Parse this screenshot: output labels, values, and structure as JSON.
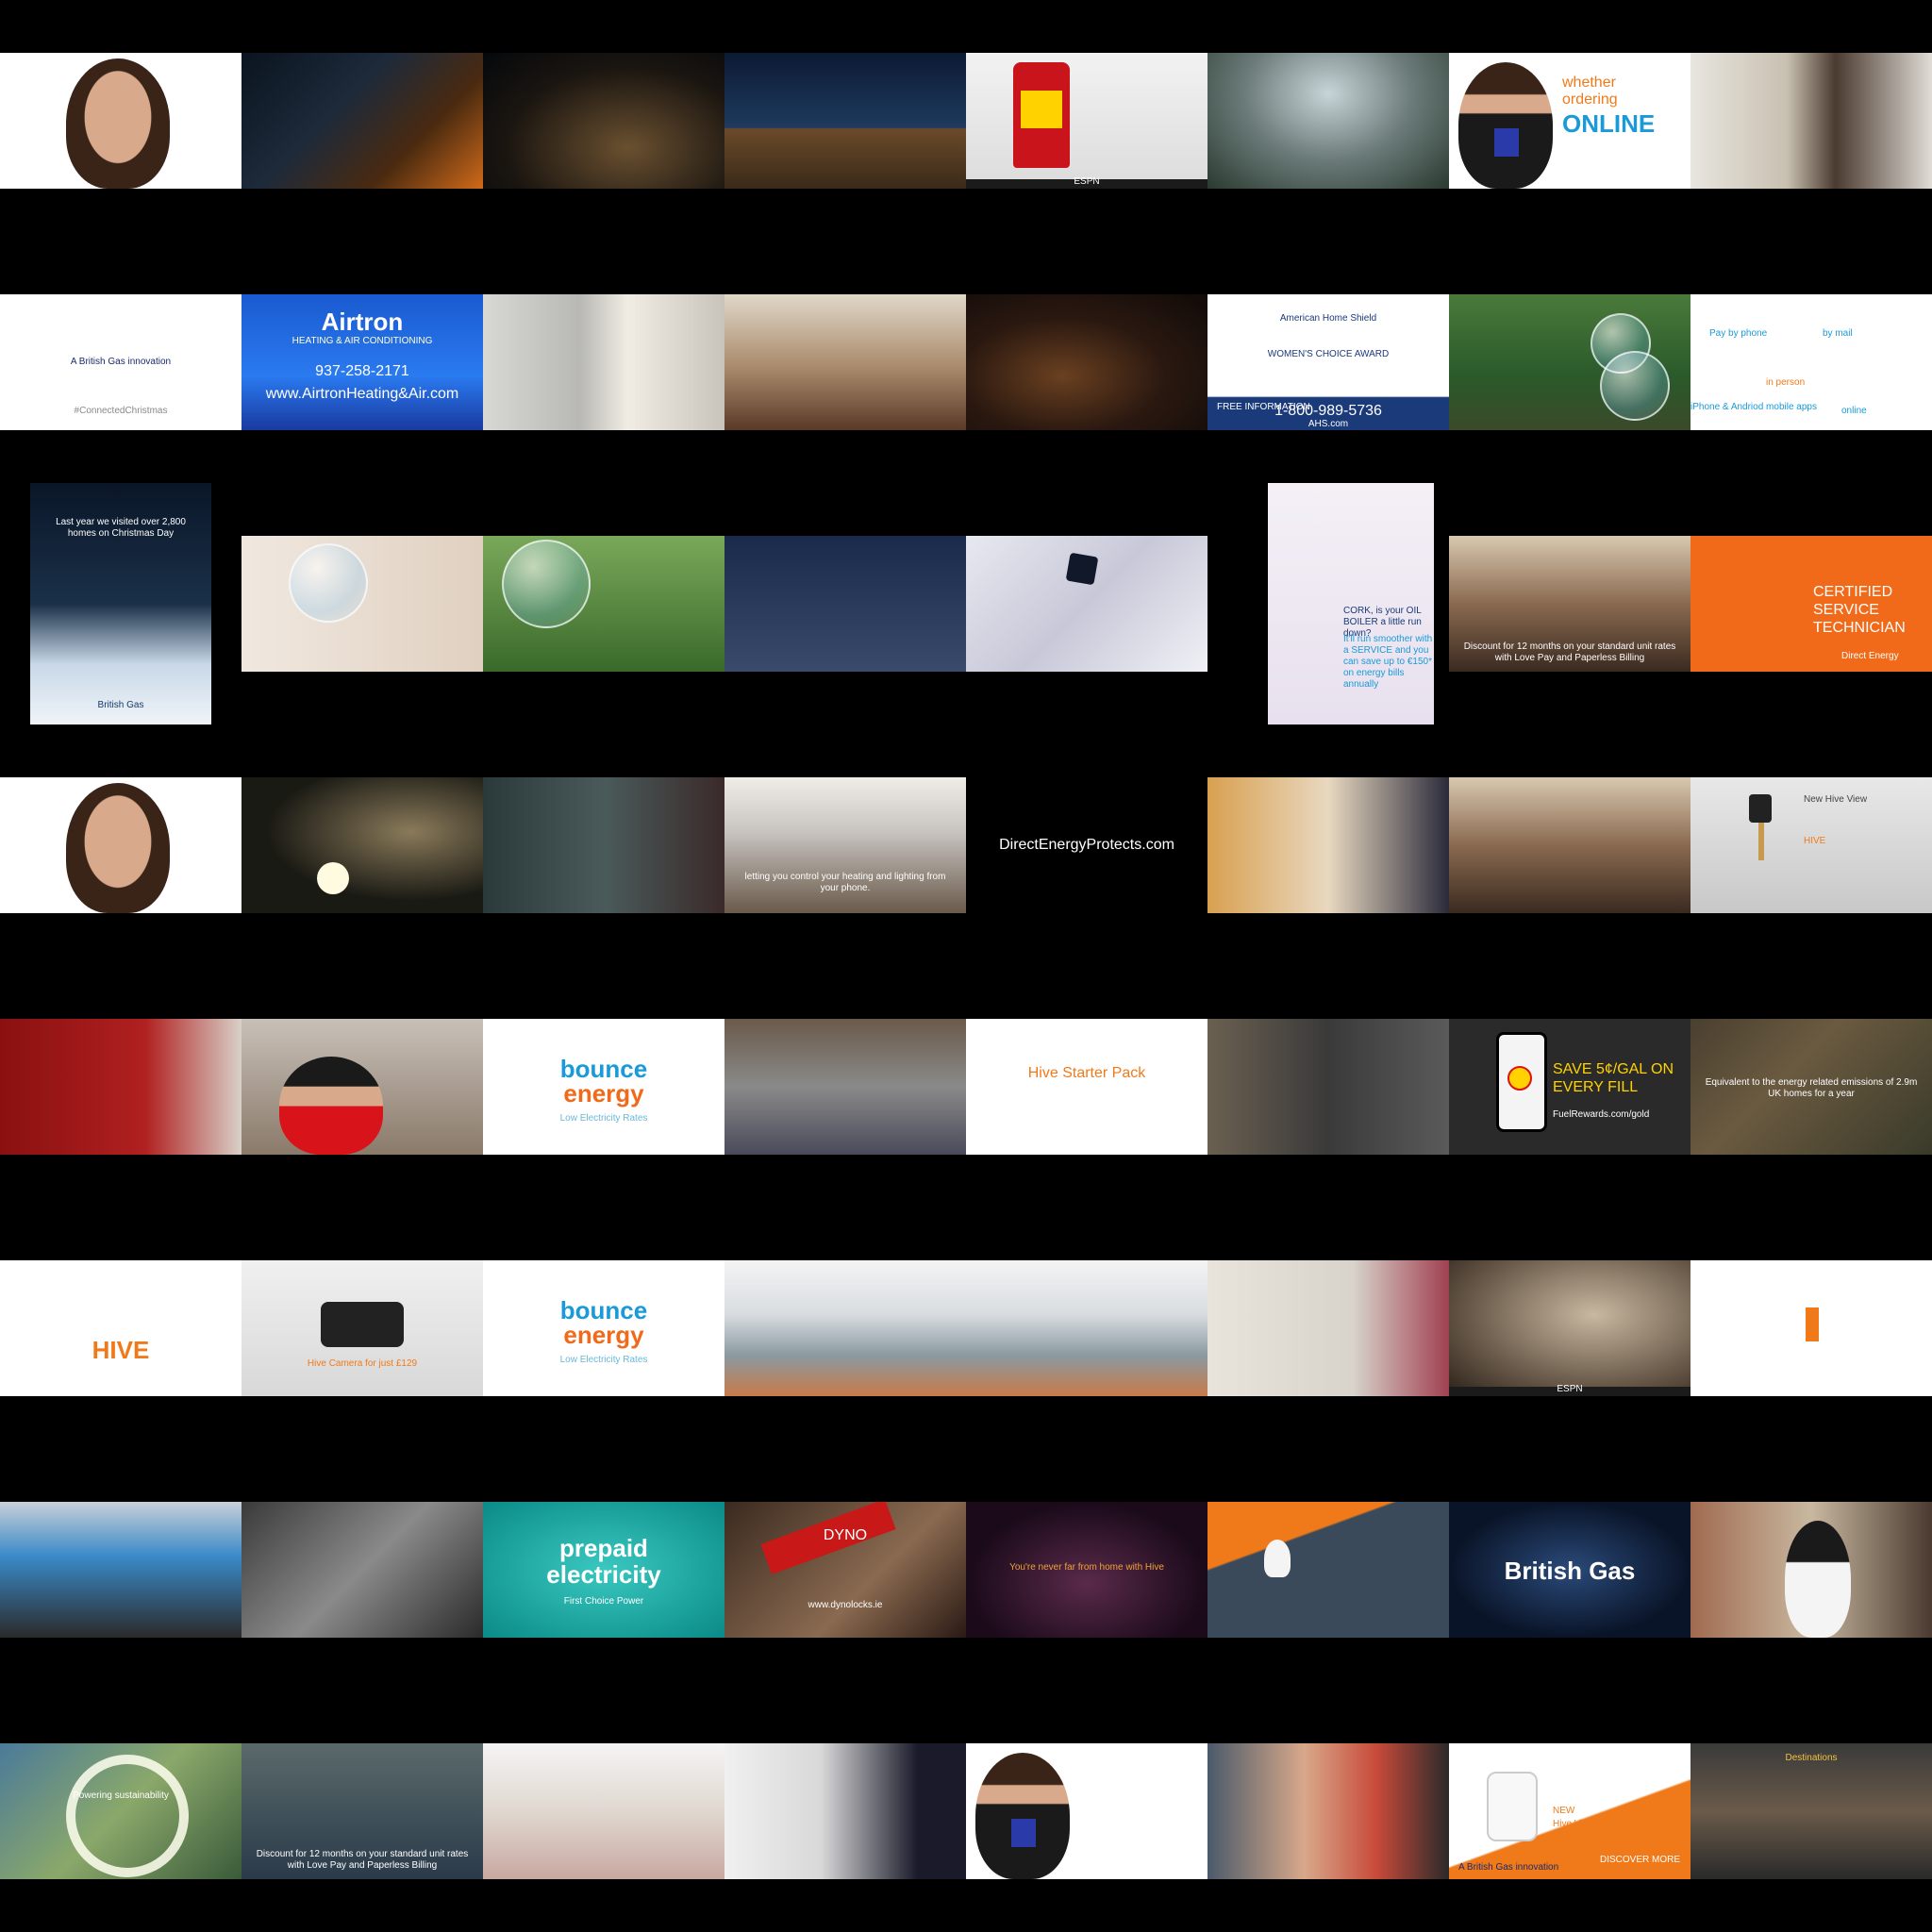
{
  "tiles": [
    {
      "id": "t00",
      "style": "face-white"
    },
    {
      "id": "t01",
      "style": "dark-oven"
    },
    {
      "id": "t02",
      "style": "night-houses"
    },
    {
      "id": "t03",
      "style": "night-cottage"
    },
    {
      "id": "t04",
      "style": "oil-bottle",
      "texts": [
        "ESPN"
      ]
    },
    {
      "id": "t05",
      "style": "misty-field"
    },
    {
      "id": "t06",
      "style": "presenter-white",
      "texts": [
        "whether",
        "ordering",
        "ONLINE"
      ]
    },
    {
      "id": "t07",
      "style": "doorway"
    },
    {
      "id": "t10",
      "style": "logo-white",
      "texts": [
        "A British Gas innovation",
        "#ConnectedChristmas"
      ]
    },
    {
      "id": "t11",
      "style": "airtron",
      "texts": [
        "Airtron",
        "HEATING & AIR CONDITIONING",
        "937-258-2171",
        "www.AirtronHeating&Air.com"
      ]
    },
    {
      "id": "t12",
      "style": "kitchen-woman"
    },
    {
      "id": "t13",
      "style": "living-couple"
    },
    {
      "id": "t14",
      "style": "night-street"
    },
    {
      "id": "t15",
      "style": "ahs",
      "texts": [
        "American Home Shield",
        "WOMEN'S CHOICE AWARD",
        "FREE INFORMATION",
        "1-800-989-5736",
        "AHS.com"
      ]
    },
    {
      "id": "t16",
      "style": "park-bubble"
    },
    {
      "id": "t17",
      "style": "contact-methods",
      "texts": [
        "Pay by phone",
        "by mail",
        "in person",
        "iPhone & Andriod mobile apps",
        "online"
      ]
    },
    {
      "id": "t20",
      "style": "poster-christmas",
      "texts": [
        "Last year we visited over 2,800 homes on Christmas Day",
        "British Gas"
      ]
    },
    {
      "id": "t21",
      "style": "shop-bubble"
    },
    {
      "id": "t22",
      "style": "forest-bubble"
    },
    {
      "id": "t23",
      "style": "floating-house"
    },
    {
      "id": "t24",
      "style": "white-device"
    },
    {
      "id": "t25",
      "style": "poster-boiler",
      "texts": [
        "CORK, is your OIL BOILER a little run down?",
        "It'll run smoother with a SERVICE and you can save up to €150* on energy bills annually"
      ]
    },
    {
      "id": "t26",
      "style": "woman-xmas",
      "texts": [
        "Discount for 12 months on your standard unit rates with Love Pay and Paperless Billing"
      ]
    },
    {
      "id": "t27",
      "style": "orange-tech",
      "texts": [
        "CERTIFIED SERVICE TECHNICIAN",
        "Direct Energy"
      ]
    },
    {
      "id": "t30",
      "style": "face-white"
    },
    {
      "id": "t31",
      "style": "dog-lights"
    },
    {
      "id": "t32",
      "style": "hallway-family"
    },
    {
      "id": "t33",
      "style": "stove",
      "texts": [
        "letting you control your heating and lighting from your phone."
      ]
    },
    {
      "id": "t34",
      "style": "black-url",
      "texts": [
        "DirectEnergyProtects.com"
      ]
    },
    {
      "id": "t35",
      "style": "door-visitors"
    },
    {
      "id": "t36",
      "style": "woman-xmas"
    },
    {
      "id": "t37",
      "style": "hive-camera",
      "texts": [
        "New Hive View",
        "HIVE"
      ]
    },
    {
      "id": "t40",
      "style": "red-wall"
    },
    {
      "id": "t41",
      "style": "shell-worker"
    },
    {
      "id": "t42",
      "style": "bounce",
      "texts": [
        "bounce",
        "energy",
        "Low Electricity Rates"
      ]
    },
    {
      "id": "t43",
      "style": "tent"
    },
    {
      "id": "t44",
      "style": "hive-pack",
      "texts": [
        "Hive Starter Pack"
      ]
    },
    {
      "id": "t45",
      "style": "man-coat"
    },
    {
      "id": "t46",
      "style": "shell-app",
      "texts": [
        "SAVE 5¢/GAL ON EVERY FILL",
        "FuelRewards.com/gold"
      ]
    },
    {
      "id": "t47",
      "style": "aerial-town",
      "texts": [
        "Equivalent to the energy related emissions of 2.9m UK homes for a year"
      ]
    },
    {
      "id": "t50",
      "style": "hive-logo",
      "texts": [
        "HIVE"
      ]
    },
    {
      "id": "t51",
      "style": "hive-phone",
      "texts": [
        "Hive Camera for just £129"
      ]
    },
    {
      "id": "t52",
      "style": "bounce",
      "texts": [
        "bounce",
        "energy",
        "Low Electricity Rates"
      ]
    },
    {
      "id": "t53",
      "style": "bright-living"
    },
    {
      "id": "t54",
      "style": "bright-living"
    },
    {
      "id": "t55",
      "style": "woman-coats"
    },
    {
      "id": "t56",
      "style": "sepia-man",
      "texts": [
        "ESPN"
      ]
    },
    {
      "id": "t57",
      "style": "hive-blank"
    },
    {
      "id": "t60",
      "style": "van"
    },
    {
      "id": "t61",
      "style": "boiler-repair"
    },
    {
      "id": "t62",
      "style": "prepaid",
      "texts": [
        "prepaid",
        "electricity",
        "First Choice Power"
      ]
    },
    {
      "id": "t63",
      "style": "dyno",
      "texts": [
        "DYNO",
        "www.dynolocks.ie"
      ]
    },
    {
      "id": "t64",
      "style": "night-hive",
      "texts": [
        "You're never far from home with Hive"
      ]
    },
    {
      "id": "t65",
      "style": "bulb-chair"
    },
    {
      "id": "t66",
      "style": "space-logo",
      "texts": [
        "British Gas"
      ]
    },
    {
      "id": "t67",
      "style": "penguin-street"
    },
    {
      "id": "t70",
      "style": "sustain",
      "texts": [
        "Powering sustainability"
      ]
    },
    {
      "id": "t71",
      "style": "couple-sofa",
      "texts": [
        "Discount for 12 months on your standard unit rates with Love Pay and Paperless Billing"
      ]
    },
    {
      "id": "t72",
      "style": "pharmacy"
    },
    {
      "id": "t73",
      "style": "tech-man"
    },
    {
      "id": "t74",
      "style": "presenter-white"
    },
    {
      "id": "t75",
      "style": "man-smile"
    },
    {
      "id": "t76",
      "style": "outdoor-cam",
      "texts": [
        "NEW",
        "Hive View Outdoor Security Camera",
        "A British Gas innovation",
        "DISCOVER MORE"
      ]
    },
    {
      "id": "t77",
      "style": "station",
      "texts": [
        "Destinations"
      ]
    }
  ]
}
